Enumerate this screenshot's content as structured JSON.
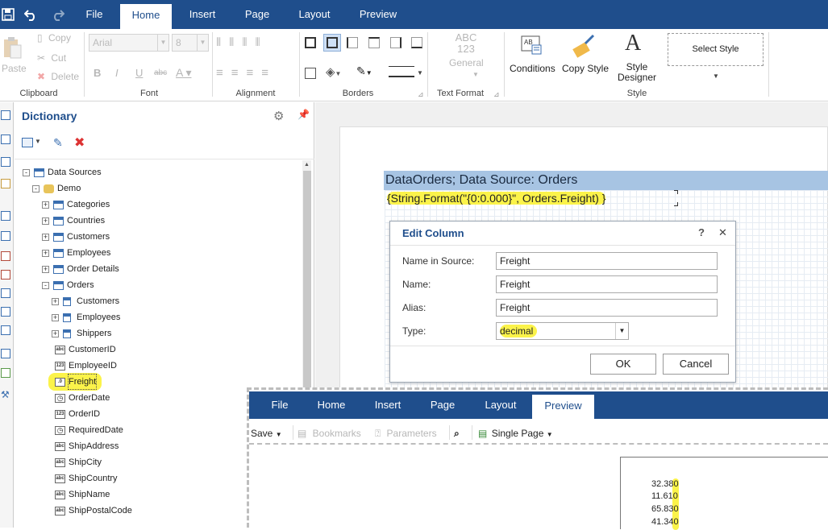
{
  "toolbar": {
    "tabs": [
      "File",
      "Home",
      "Insert",
      "Page",
      "Layout",
      "Preview"
    ],
    "active_tab": "Home"
  },
  "ribbon": {
    "clipboard": {
      "label": "Clipboard",
      "paste": "Paste",
      "copy": "Copy",
      "cut": "Cut",
      "delete": "Delete"
    },
    "font": {
      "label": "Font",
      "family": "Arial",
      "size": "8"
    },
    "alignment": {
      "label": "Alignment"
    },
    "borders": {
      "label": "Borders"
    },
    "text_format": {
      "label": "Text Format",
      "abc": "ABC",
      "num": "123",
      "general": "General"
    },
    "style": {
      "label": "Style",
      "conditions": "Conditions",
      "copy_style": "Copy Style",
      "style_designer_1": "Style",
      "style_designer_2": "Designer",
      "select_style": "Select Style"
    }
  },
  "dictionary": {
    "title": "Dictionary",
    "tree": [
      {
        "label": "Data Sources",
        "level": 0,
        "kind": "table",
        "exp": "-"
      },
      {
        "label": "Demo",
        "level": 1,
        "kind": "db",
        "exp": "-"
      },
      {
        "label": "Categories",
        "level": 2,
        "kind": "table",
        "exp": "+"
      },
      {
        "label": "Countries",
        "level": 2,
        "kind": "table",
        "exp": "+"
      },
      {
        "label": "Customers",
        "level": 2,
        "kind": "table",
        "exp": "+"
      },
      {
        "label": "Employees",
        "level": 2,
        "kind": "table",
        "exp": "+"
      },
      {
        "label": "Order Details",
        "level": 2,
        "kind": "table",
        "exp": "+"
      },
      {
        "label": "Orders",
        "level": 2,
        "kind": "table",
        "exp": "-"
      },
      {
        "label": "Customers",
        "level": 3,
        "kind": "rel",
        "exp": "+"
      },
      {
        "label": "Employees",
        "level": 3,
        "kind": "rel",
        "exp": "+"
      },
      {
        "label": "Shippers",
        "level": 3,
        "kind": "rel",
        "exp": "+"
      },
      {
        "label": "CustomerID",
        "level": 3,
        "kind": "abc",
        "exp": ""
      },
      {
        "label": "EmployeeID",
        "level": 3,
        "kind": "123",
        "exp": ""
      },
      {
        "label": "Freight",
        "level": 3,
        "kind": ".0",
        "exp": "",
        "highlight": true
      },
      {
        "label": "OrderDate",
        "level": 3,
        "kind": "clock",
        "exp": ""
      },
      {
        "label": "OrderID",
        "level": 3,
        "kind": "123",
        "exp": ""
      },
      {
        "label": "RequiredDate",
        "level": 3,
        "kind": "clock",
        "exp": ""
      },
      {
        "label": "ShipAddress",
        "level": 3,
        "kind": "abc",
        "exp": ""
      },
      {
        "label": "ShipCity",
        "level": 3,
        "kind": "abc",
        "exp": ""
      },
      {
        "label": "ShipCountry",
        "level": 3,
        "kind": "abc",
        "exp": ""
      },
      {
        "label": "ShipName",
        "level": 3,
        "kind": "abc",
        "exp": ""
      },
      {
        "label": "ShipPostalCode",
        "level": 3,
        "kind": "abc",
        "exp": ""
      }
    ]
  },
  "designer": {
    "band_header": "DataOrders; Data Source: Orders",
    "expression": "{String.Format(\"{0:0.000}\", Orders.Freight) }"
  },
  "dialog": {
    "title": "Edit Column",
    "help": "?",
    "close": "✕",
    "fields": [
      {
        "label": "Name in Source:",
        "value": "Freight"
      },
      {
        "label": "Name:",
        "value": "Freight"
      },
      {
        "label": "Alias:",
        "value": "Freight"
      }
    ],
    "type_label": "Type:",
    "type_value": "decimal",
    "ok": "OK",
    "cancel": "Cancel"
  },
  "preview": {
    "tabs": [
      "File",
      "Home",
      "Insert",
      "Page",
      "Layout",
      "Preview"
    ],
    "active_tab": "Preview",
    "save": "Save",
    "bookmarks": "Bookmarks",
    "parameters": "Parameters",
    "single_page": "Single Page",
    "values": [
      "32.380",
      "11.610",
      "65.830",
      "41.340"
    ]
  },
  "colors": {
    "brand": "#1f4e8c",
    "highlight": "#fbf34a",
    "band": "#a7c4e3"
  }
}
